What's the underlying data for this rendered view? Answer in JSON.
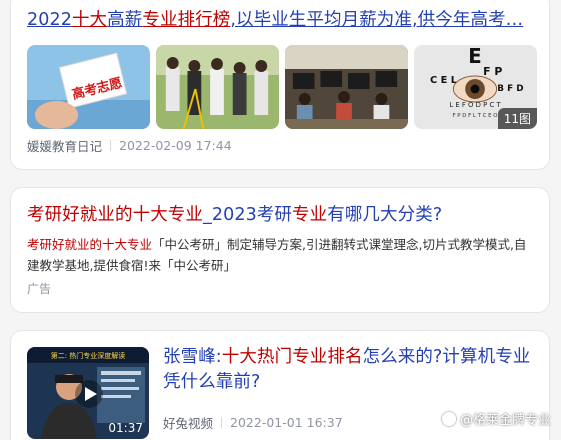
{
  "results": [
    {
      "title_parts": [
        {
          "text": "2022",
          "hl": false
        },
        {
          "text": "十大",
          "hl": true
        },
        {
          "text": "高薪",
          "hl": false
        },
        {
          "text": "专业排行榜",
          "hl": true
        },
        {
          "text": ",以毕业生平均月薪为准,供今年高考…",
          "hl": false
        }
      ],
      "thumb_texts": {
        "t1_sign": "高考志愿",
        "t4_chart_1": "E",
        "t4_chart_2": "F P",
        "t4_chart_3": "C E L",
        "t4_chart_4": "B F D",
        "t4_chart_5": "L E F O D P C T",
        "t4_chart_6": "F P D F L T C E O"
      },
      "image_count": "11图",
      "source": "媛媛教育日记",
      "time": "2022-02-09 17:44"
    },
    {
      "title_parts": [
        {
          "text": "考研好就业的",
          "hl": true
        },
        {
          "text": "十大专业",
          "hl": true
        },
        {
          "text": "_2023考研",
          "hl": false
        },
        {
          "text": "专业",
          "hl": true
        },
        {
          "text": "有哪几大分类?",
          "hl": false
        }
      ],
      "desc_parts": [
        {
          "text": "考研好就业的十大专业",
          "hl": true
        },
        {
          "text": "「中公考研」制定辅导方案,引进翻转式课堂理念,切片式教学模式,自建教学基地,提供食宿!来「中公考研」",
          "hl": false
        }
      ],
      "ad_label": "广告"
    },
    {
      "title_parts": [
        {
          "text": "张雪峰:",
          "hl": false
        },
        {
          "text": "十大热门专业排名",
          "hl": true
        },
        {
          "text": "怎么来的?计算机专业凭什么靠前?",
          "hl": false
        }
      ],
      "video_overlay": "第二: 热门专业深度解读",
      "duration": "01:37",
      "source": "好兔视频",
      "time": "2022-01-01 16:37"
    }
  ],
  "watermark": "@格莱金牌专业"
}
